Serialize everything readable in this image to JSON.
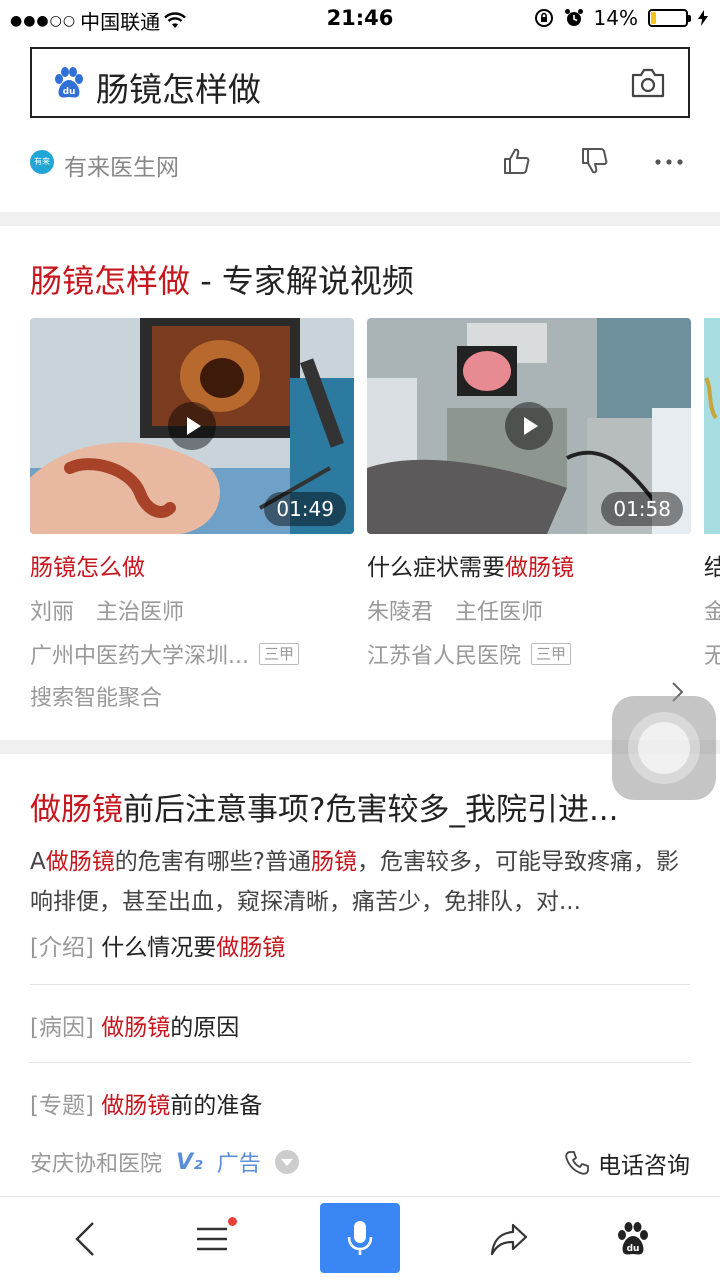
{
  "status_bar": {
    "signal_dots": "●●●○○",
    "carrier": "中国联通",
    "time": "21:46",
    "battery": "14%",
    "battery_level": 0.14
  },
  "search": {
    "query": "肠镜怎样做",
    "logo_text": "du"
  },
  "source": {
    "logo_text": "有来",
    "name": "有来医生网"
  },
  "video_section": {
    "title_highlight": "肠镜怎样做",
    "title_rest": " - 专家解说视频",
    "videos": [
      {
        "duration": "01:49",
        "title_plain": "",
        "title_highlight": "肠镜怎么做",
        "doctor": "刘丽　主治医师",
        "hospital": "广州中医药大学深圳...",
        "grade": "三甲"
      },
      {
        "duration": "01:58",
        "title_plain": "什么症状需要",
        "title_highlight": "做肠镜",
        "doctor": "朱陵君　主任医师",
        "hospital": "江苏省人民医院",
        "grade": "三甲"
      },
      {
        "title_plain": "结",
        "doctor": "金",
        "hospital": "无"
      }
    ],
    "aggregate_label": "搜索智能聚合"
  },
  "result": {
    "title_highlight": "做肠镜",
    "title_rest": "前后注意事项?危害较多_我院引进...",
    "body": {
      "p1": "A",
      "h1": "做肠镜",
      "p2": "的危害有哪些?普通",
      "h2": "肠镜",
      "p3": "，危害较多，可能导致疼痛，影响排便，甚至出血，窥探清晰，痛苦少，免排队，对..."
    },
    "sublinks": [
      {
        "bracket": "[介绍]",
        "plain_before": " 什么情况要",
        "highlight": "做肠镜",
        "plain_after": ""
      },
      {
        "bracket": "[病因]",
        "plain_before": " ",
        "highlight": "做肠镜",
        "plain_after": "的原因"
      },
      {
        "bracket": "[专题]",
        "plain_before": " ",
        "highlight": "做肠镜",
        "plain_after": "前的准备"
      }
    ],
    "advertiser": "安庆协和医院",
    "v_badge": "V₂",
    "ad_label": "广告",
    "phone_label": "电话咨询"
  },
  "colors": {
    "highlight_red": "#c7161d",
    "accent_blue": "#3a86f5",
    "battery_yellow": "#f5c518"
  }
}
